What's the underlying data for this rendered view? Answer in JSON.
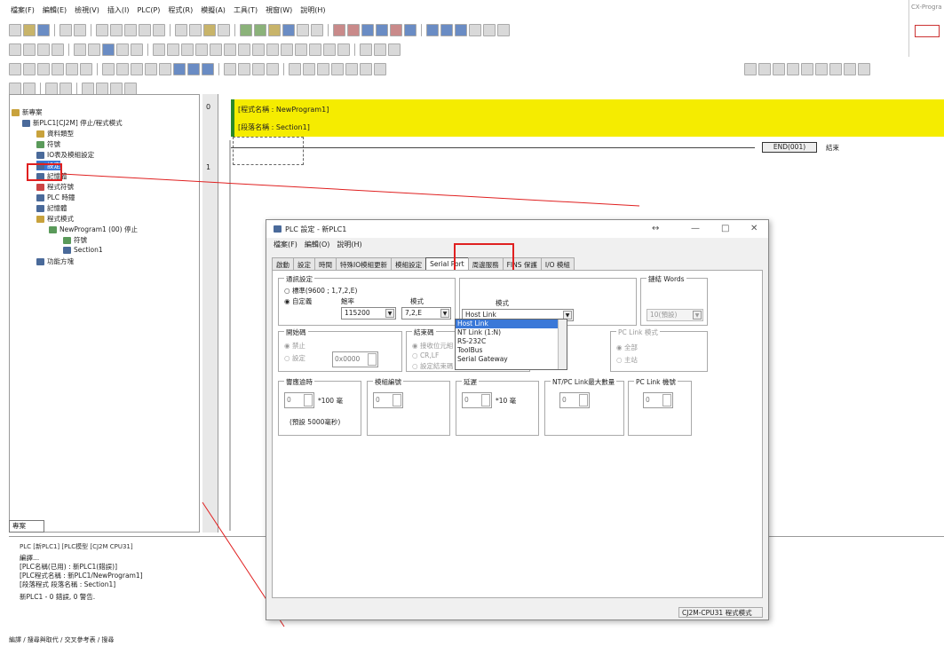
{
  "menubar": [
    "檔案(F)",
    "編輯(E)",
    "檢視(V)",
    "插入(I)",
    "PLC(P)",
    "程式(R)",
    "模擬(A)",
    "工具(T)",
    "視窗(W)",
    "說明(H)"
  ],
  "logo": {
    "text": "CX-Progra"
  },
  "tree": {
    "root": "新專案",
    "plc": "新PLC1[CJ2M] 停止/程式模式",
    "items": [
      "資料類型",
      "符號",
      "IO表及模組設定",
      "設定",
      "記憶體",
      "程式符號",
      "PLC 時鐘",
      "記憶體",
      "程式模式",
      "NewProgram1 (00) 停止",
      "符號",
      "Section1",
      "功能方塊"
    ],
    "tab": "專案"
  },
  "ladder": {
    "row0": "0",
    "row1": "1",
    "program_name": "[程式名稱 : NewProgram1]",
    "section_name": "[段落名稱 : Section1]",
    "end_label": "END(001)",
    "end_text": "結束"
  },
  "output": {
    "tabs": "PLC [新PLC1] [PLC模型 [CJ2M CPU31]",
    "lines": [
      "編譯...",
      "[PLC名稱(已用) : 新PLC1(錯誤)]",
      "[PLC程式名稱 : 新PLC1/NewProgram1]",
      "[段落程式 段落名稱 : Section1]",
      "新PLC1 - 0 錯誤, 0 警告."
    ],
    "bottom_tabs": "編譯 / 搜尋與取代 / 交叉參考表 / 搜尋"
  },
  "dialog": {
    "title": "PLC 設定 - 新PLC1",
    "menu": [
      "檔案(F)",
      "編輯(O)",
      "說明(H)"
    ],
    "tabs": [
      "啟動",
      "設定",
      "時間",
      "特殊IO模組更新",
      "模組設定",
      "Serial Port",
      "周邊服務",
      "FINS 保護",
      "I/O 模組"
    ],
    "active_tab": "Serial Port",
    "comm": {
      "caption": "通訊設定",
      "opt_std": "標準(9600 ; 1,7,2,E)",
      "opt_custom": "自定義",
      "baud_label": "鮑率",
      "baud_value": "115200",
      "format_label": "模式",
      "format_value": "7,2,E"
    },
    "mode": {
      "label": "模式",
      "value": "Host Link",
      "options": [
        "Host Link",
        "NT Link (1:N)",
        "RS-232C",
        "ToolBus",
        "Serial Gateway"
      ]
    },
    "link_words": {
      "caption": "鏈結 Words",
      "value": "10(預設)"
    },
    "start_code": {
      "caption": "開始碼",
      "opt_disable": "禁止",
      "opt_set": "設定",
      "value": "0x0000"
    },
    "end_code": {
      "caption": "結束碼",
      "opt1": "接收位元組",
      "opt2": "CR,LF",
      "opt3": "設定結束碼"
    },
    "pc_link": {
      "caption": "PC Link 模式",
      "opt_all": "全部",
      "opt_master": "主站"
    },
    "timeout": {
      "caption": "響應逾時",
      "value": "0",
      "unit": "*100 毫",
      "note": "(預設 5000毫秒)"
    },
    "node": {
      "caption": "模組編號",
      "value": "0"
    },
    "delay": {
      "caption": "延遲",
      "value": "0",
      "unit": "*10 毫"
    },
    "nt_max": {
      "caption": "NT/PC Link最大數量",
      "value": "0"
    },
    "pc_unit": {
      "caption": "PC Link 機號",
      "value": "0"
    },
    "status": "CJ2M-CPU31 程式模式"
  },
  "colors": {
    "highlight": "#e02020",
    "ladder_header": "#f5ec00",
    "selection": "#3a78d8"
  }
}
